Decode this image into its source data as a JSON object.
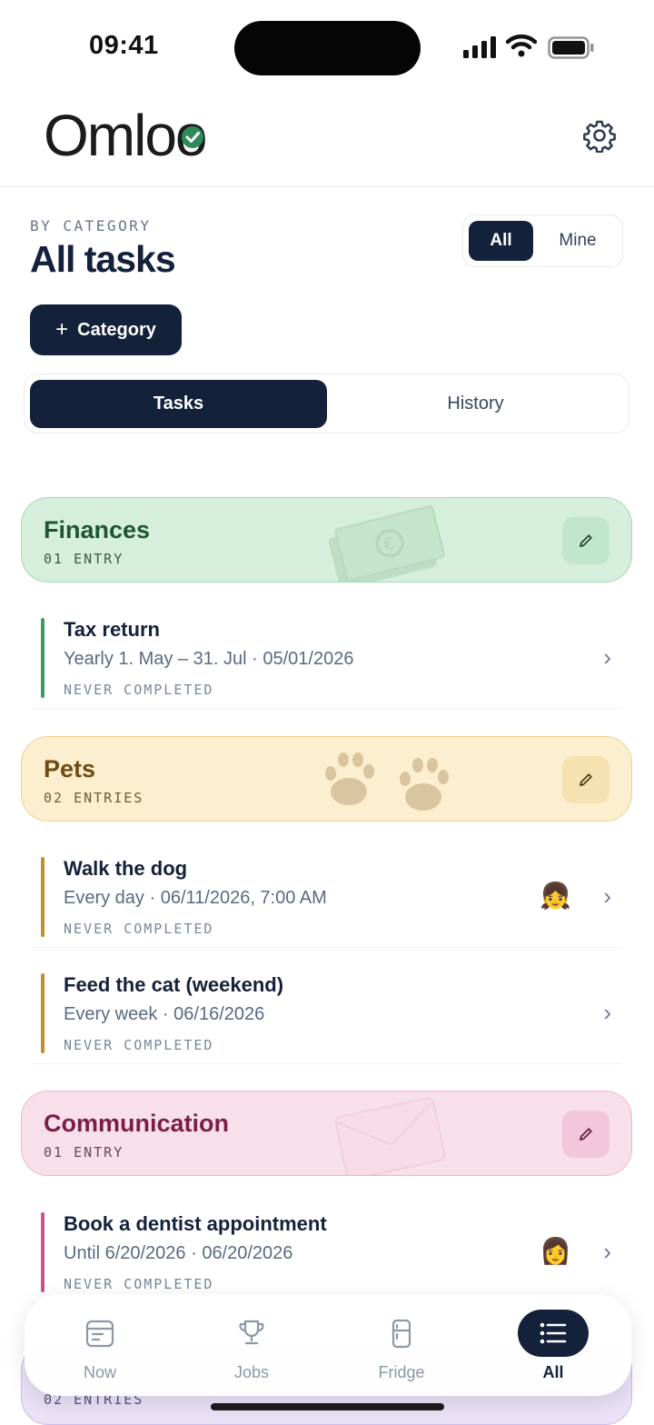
{
  "status_bar": {
    "time": "09:41"
  },
  "header": {
    "logo_text": "Omlo",
    "logo_check_color": "#2e8b57"
  },
  "page": {
    "eyebrow": "BY CATEGORY",
    "title": "All tasks",
    "filter": {
      "all_label": "All",
      "mine_label": "Mine",
      "selected": "All"
    },
    "add_category_label": "Category",
    "tabs": {
      "tasks_label": "Tasks",
      "history_label": "History",
      "selected": "Tasks"
    }
  },
  "categories": [
    {
      "name": "Finances",
      "count_label": "01 ENTRY",
      "color": "#2e8b57",
      "tasks": [
        {
          "name": "Tax return",
          "schedule": "Yearly 1. May – 31. Jul · 05/01/2026",
          "status": "NEVER COMPLETED",
          "avatar": ""
        }
      ]
    },
    {
      "name": "Pets",
      "count_label": "02 ENTRIES",
      "color": "#c0902b",
      "tasks": [
        {
          "name": "Walk the dog",
          "schedule": "Every day · 06/11/2026, 7:00 AM",
          "status": "NEVER COMPLETED",
          "avatar": "👧"
        },
        {
          "name": "Feed the cat (weekend)",
          "schedule": "Every week · 06/16/2026",
          "status": "NEVER COMPLETED",
          "avatar": ""
        }
      ]
    },
    {
      "name": "Communication",
      "count_label": "01 ENTRY",
      "color": "#d04f8a",
      "tasks": [
        {
          "name": "Book a dentist appointment",
          "schedule": "Until 6/20/2026 · 06/20/2026",
          "status": "NEVER COMPLETED",
          "avatar": "👩"
        }
      ]
    },
    {
      "name": "",
      "count_label": "02 ENTRIES",
      "color": "#8a6fc4",
      "tasks": []
    }
  ],
  "bottom_nav": {
    "items": [
      {
        "label": "Now",
        "icon": "calendar-icon"
      },
      {
        "label": "Jobs",
        "icon": "trophy-icon"
      },
      {
        "label": "Fridge",
        "icon": "fridge-icon"
      },
      {
        "label": "All",
        "icon": "list-icon"
      }
    ],
    "selected": "All"
  }
}
